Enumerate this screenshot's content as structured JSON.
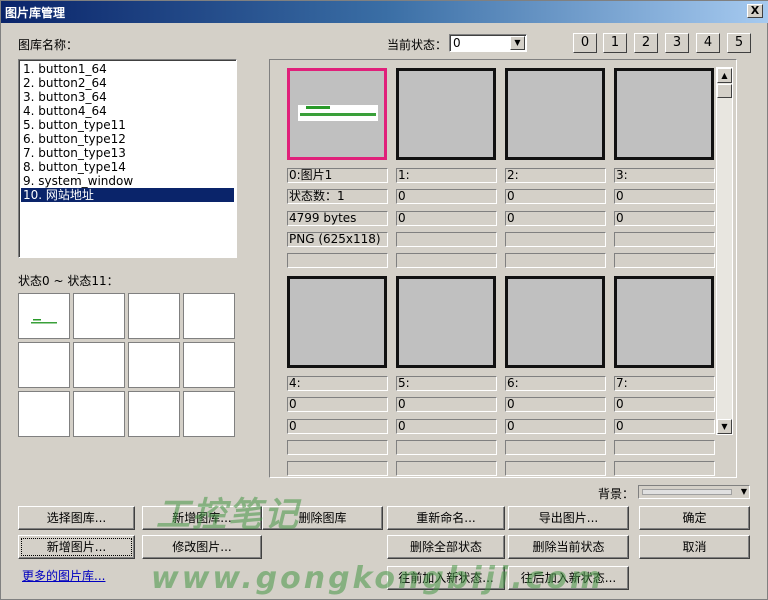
{
  "window": {
    "title": "图片库管理",
    "close_label": "X"
  },
  "library_label": "图库名称：",
  "libraries": [
    "1. button1_64",
    "2. button2_64",
    "3. button3_64",
    "4. button4_64",
    "5. button_type11",
    "6. button_type12",
    "7. button_type13",
    "8. button_type14",
    "9. system_window",
    "10. 网站地址"
  ],
  "selected_library_index": 9,
  "state_range_label": "状态0 ~ 状态11：",
  "current_state": {
    "label": "当前状态：",
    "value": "0"
  },
  "state_buttons": [
    "0",
    "1",
    "2",
    "3",
    "4",
    "5"
  ],
  "images": [
    {
      "index": "0:图片1",
      "states": "状态数：1",
      "size": "4799 bytes",
      "format": "PNG (625x118)",
      "extra": "",
      "selected": true,
      "has_picture": true
    },
    {
      "index": "1:",
      "states": "0",
      "size": "0",
      "format": "",
      "extra": ""
    },
    {
      "index": "2:",
      "states": "0",
      "size": "0",
      "format": "",
      "extra": ""
    },
    {
      "index": "3:",
      "states": "0",
      "size": "0",
      "format": "",
      "extra": ""
    },
    {
      "index": "4:",
      "states": "0",
      "size": "0",
      "format": "",
      "extra": ""
    },
    {
      "index": "5:",
      "states": "0",
      "size": "0",
      "format": "",
      "extra": ""
    },
    {
      "index": "6:",
      "states": "0",
      "size": "0",
      "format": "",
      "extra": ""
    },
    {
      "index": "7:",
      "states": "0",
      "size": "0",
      "format": "",
      "extra": ""
    }
  ],
  "background_label": "背景：",
  "buttons": {
    "select_library": "选择图库...",
    "new_library": "新增图库...",
    "delete_library": "删除图库",
    "rename": "重新命名...",
    "export_image": "导出图片...",
    "ok": "确定",
    "new_image": "新增图片...",
    "modify_image": "修改图片...",
    "delete_all_states": "删除全部状态",
    "delete_current_state": "删除当前状态",
    "cancel": "取消",
    "insert_state_before": "往前加入新状态...",
    "insert_state_after": "往后加入新状态..."
  },
  "more_libraries_link": "更多的图片库...",
  "watermark": {
    "line1": "工控笔记",
    "line2": "www.gongkongbiji.com"
  },
  "colors": {
    "selection": "#0a246a",
    "selected_border": "#e0207a",
    "link": "#0000c0"
  }
}
